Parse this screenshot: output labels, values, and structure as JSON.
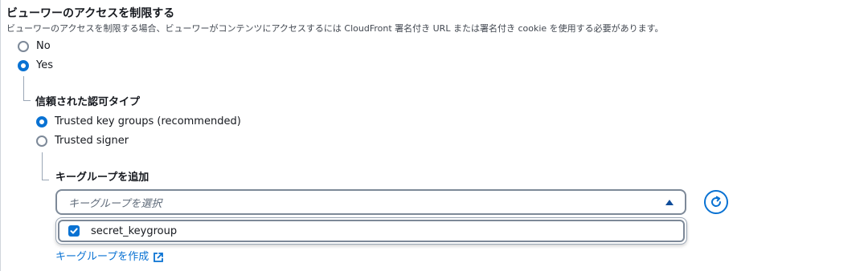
{
  "section": {
    "title": "ビューワーのアクセスを制限する",
    "description": "ビューワーのアクセスを制限する場合、ビューワーがコンテンツにアクセスするには CloudFront 署名付き URL または署名付き cookie を使用する必要があります。",
    "options": [
      {
        "label": "No",
        "checked": false
      },
      {
        "label": "Yes",
        "checked": true
      }
    ]
  },
  "auth_type": {
    "title": "信頼された認可タイプ",
    "options": [
      {
        "label": "Trusted key groups (recommended)",
        "checked": true
      },
      {
        "label": "Trusted signer",
        "checked": false
      }
    ]
  },
  "key_group": {
    "title": "キーグループを追加",
    "select_placeholder": "キーグループを選択",
    "dropdown_options": [
      {
        "label": "secret_keygroup",
        "checked": true
      }
    ],
    "create_link": "キーグループを作成"
  },
  "colors": {
    "accent": "#0972d3",
    "text": "#16191f",
    "border": "#7d8998"
  },
  "icons": {
    "refresh": "refresh-icon",
    "external": "external-link-icon",
    "caret": "caret-up-icon",
    "check": "check-icon"
  }
}
